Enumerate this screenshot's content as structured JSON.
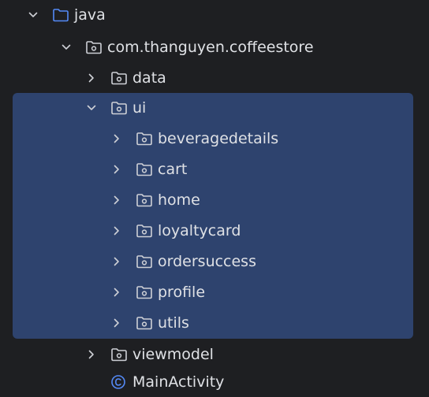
{
  "tree": {
    "java": {
      "label": "java"
    },
    "package": {
      "label": "com.thanguyen.coffeestore"
    },
    "data": {
      "label": "data"
    },
    "ui": {
      "label": "ui"
    },
    "ui_children": [
      {
        "label": "beveragedetails"
      },
      {
        "label": "cart"
      },
      {
        "label": "home"
      },
      {
        "label": "loyaltycard"
      },
      {
        "label": "ordersuccess"
      },
      {
        "label": "profile"
      },
      {
        "label": "utils"
      }
    ],
    "viewmodel": {
      "label": "viewmodel"
    },
    "main_activity": {
      "label": "MainActivity"
    }
  },
  "colors": {
    "background": "#1e1f22",
    "selection": "#2e436e",
    "text": "#dfe1e5",
    "icon": "#ced0d6",
    "java_folder": "#548af7"
  }
}
